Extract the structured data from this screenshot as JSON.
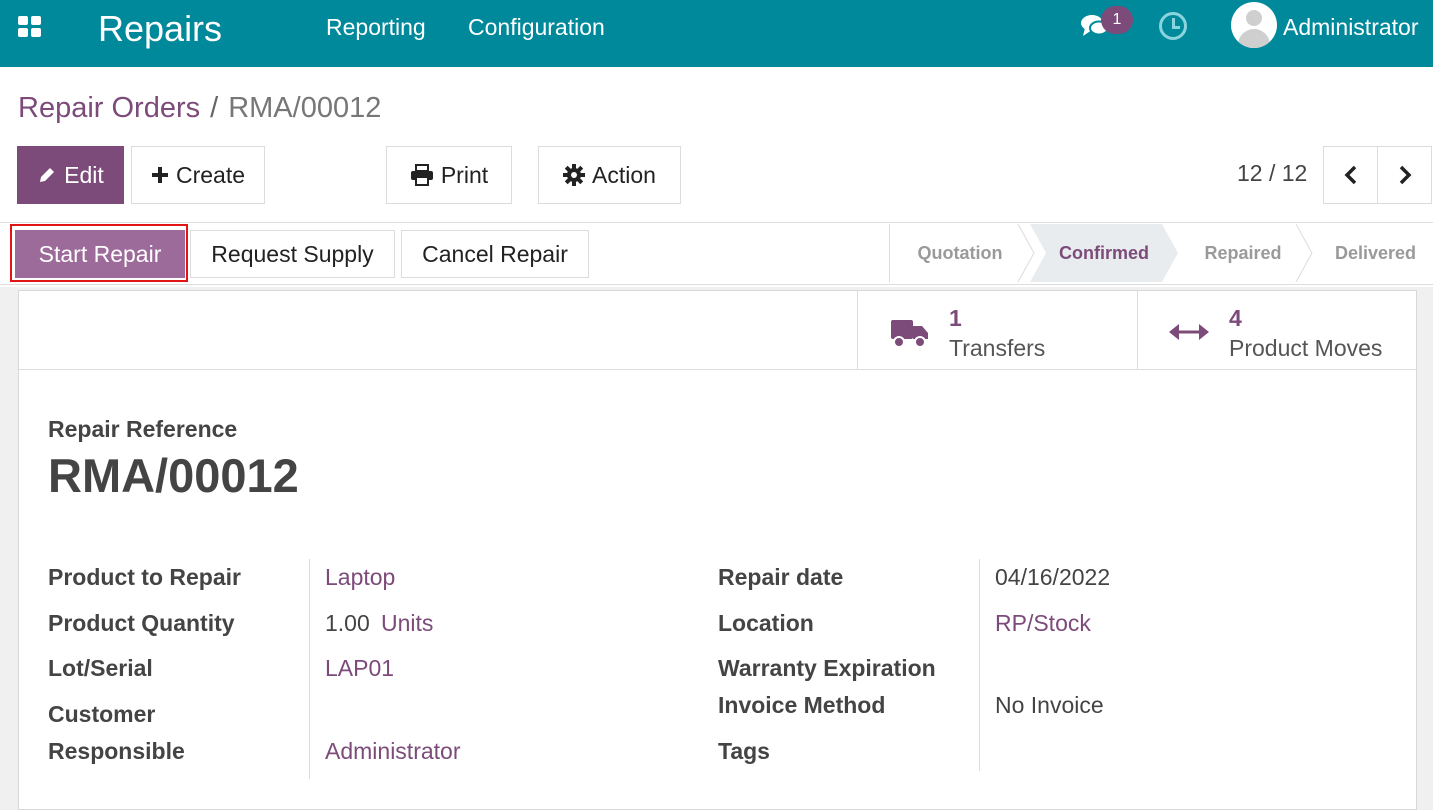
{
  "topbar": {
    "app_name": "Repairs",
    "menu": [
      "Reporting",
      "Configuration"
    ],
    "message_count": "1",
    "user": "Administrator",
    "color": "#00899b"
  },
  "breadcrumb": {
    "parent": "Repair Orders",
    "separator": "/",
    "current": "RMA/00012"
  },
  "toolbar": {
    "edit": "Edit",
    "create": "Create",
    "print": "Print",
    "action": "Action"
  },
  "pager": {
    "value": "12 / 12"
  },
  "status_buttons": {
    "start": "Start Repair",
    "supply": "Request Supply",
    "cancel": "Cancel Repair"
  },
  "stages": [
    "Quotation",
    "Confirmed",
    "Repaired",
    "Delivered"
  ],
  "active_stage": "Confirmed",
  "smart_buttons": [
    {
      "count": "1",
      "label": "Transfers",
      "icon": "truck-icon"
    },
    {
      "count": "4",
      "label": "Product Moves",
      "icon": "arrows-h-icon"
    }
  ],
  "record": {
    "ref_label": "Repair Reference",
    "ref": "RMA/00012",
    "left": {
      "product_label": "Product to Repair",
      "product": "Laptop",
      "qty_label": "Product Quantity",
      "qty": "1.00",
      "uom": "Units",
      "lot_label": "Lot/Serial",
      "lot": "LAP01",
      "customer_label": "Customer",
      "customer": "",
      "responsible_label": "Responsible",
      "responsible": "Administrator"
    },
    "right": {
      "date_label": "Repair date",
      "date": "04/16/2022",
      "location_label": "Location",
      "location": "RP/Stock",
      "warranty_label": "Warranty Expiration",
      "warranty": "",
      "invoice_label": "Invoice Method",
      "invoice": "No Invoice",
      "tags_label": "Tags",
      "tags": ""
    }
  },
  "colors": {
    "primary": "#7c4b7a",
    "highlight_border": "#e31414"
  }
}
